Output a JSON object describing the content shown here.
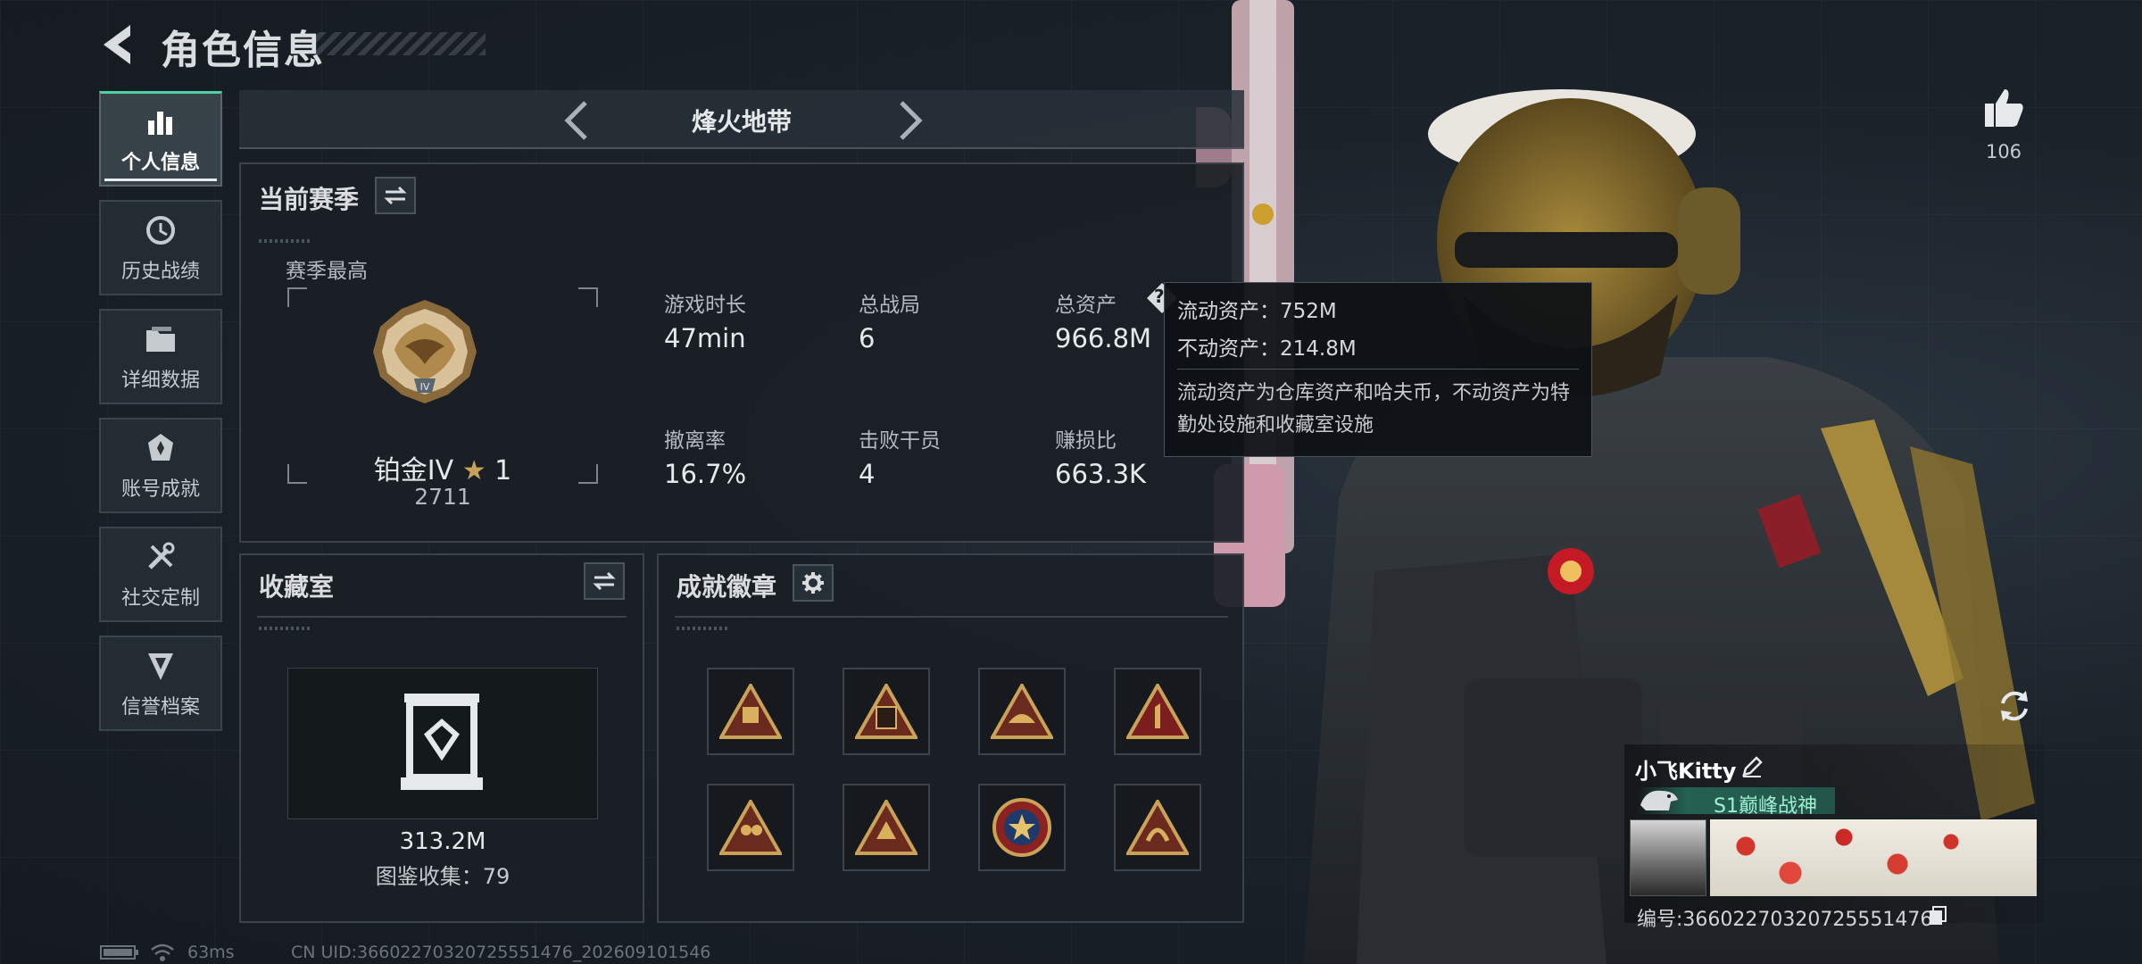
{
  "header": {
    "title": "角色信息"
  },
  "nav": {
    "items": [
      {
        "label": "个人信息",
        "icon": "bar-chart-icon",
        "active": true
      },
      {
        "label": "历史战绩",
        "icon": "history-clock-icon",
        "active": false
      },
      {
        "label": "详细数据",
        "icon": "folder-icon",
        "active": false
      },
      {
        "label": "账号成就",
        "icon": "achievement-medal-icon",
        "active": false
      },
      {
        "label": "社交定制",
        "icon": "wrench-screwdriver-icon",
        "active": false
      },
      {
        "label": "信誉档案",
        "icon": "reputation-shield-icon",
        "active": false
      }
    ]
  },
  "mode": {
    "title": "烽火地带"
  },
  "season": {
    "title": "当前赛季",
    "best_label": "赛季最高",
    "rank": "铂金IV",
    "stars": "1",
    "score": "2711",
    "stats": [
      {
        "label": "游戏时长",
        "value": "47min"
      },
      {
        "label": "总战局",
        "value": "6"
      },
      {
        "label": "总资产",
        "value": "966.8M"
      },
      {
        "label": "撤离率",
        "value": "16.7%"
      },
      {
        "label": "击败干员",
        "value": "4"
      },
      {
        "label": "赚损比",
        "value": "663.3K"
      }
    ]
  },
  "tooltip": {
    "liquid": "流动资产：752M",
    "fixed": "不动资产：214.8M",
    "desc": "流动资产为仓库资产和哈夫币，不动资产为特勤处设施和收藏室设施"
  },
  "collection": {
    "title": "收藏室",
    "value": "313.2M",
    "catalog": "图鉴收集：79"
  },
  "badges": {
    "title": "成就徽章",
    "items": [
      "badge-1",
      "badge-2",
      "badge-3",
      "badge-4",
      "badge-5",
      "badge-6",
      "badge-7",
      "badge-8"
    ]
  },
  "player": {
    "name": "小飞Kitty",
    "title": "S1巅峰战神",
    "card_id": "编号:36602270320725551476"
  },
  "likes": {
    "count": "106"
  },
  "footer": {
    "ping": "63ms",
    "uid": "CN UID:36602270320725551476_202609101546"
  },
  "colors": {
    "accent": "#4fd1a5",
    "panel": "#1a1f25",
    "border": "#3a434b",
    "gold": "#c9a257"
  }
}
